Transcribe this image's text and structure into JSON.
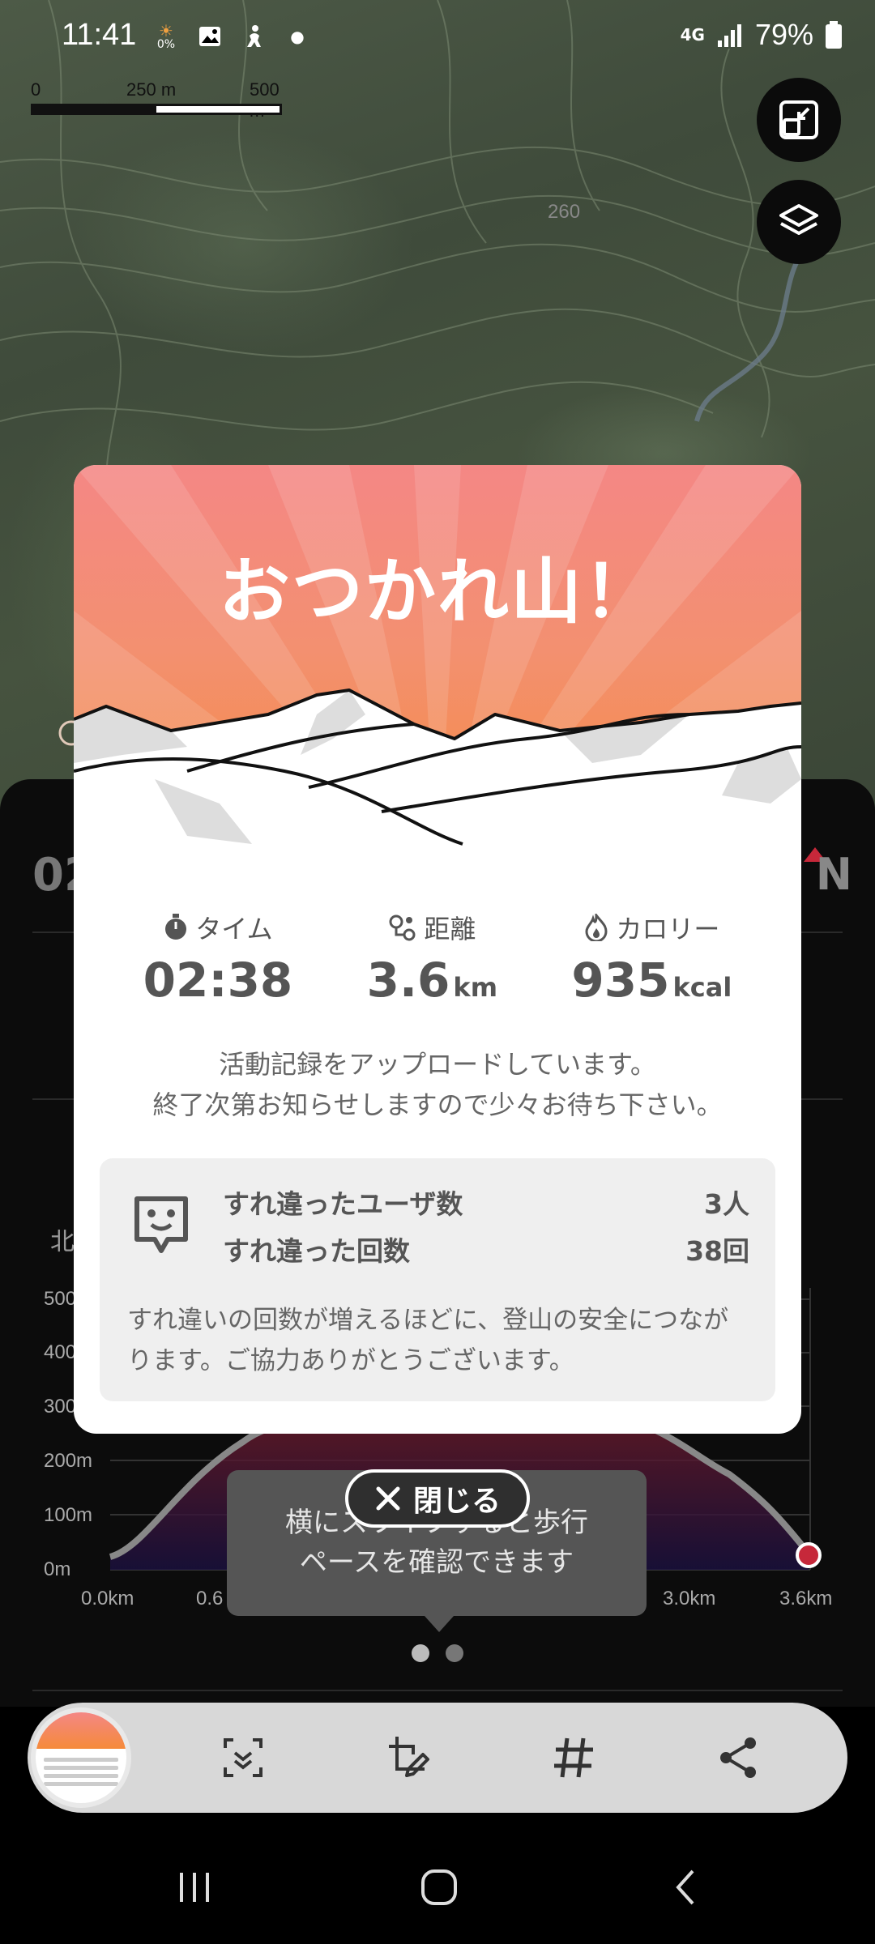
{
  "status_bar": {
    "time": "11:41",
    "small_percent": "0%",
    "network": "4G",
    "battery": "79%"
  },
  "map": {
    "scale_labels": [
      "0",
      "250 m",
      "500 m"
    ],
    "contour_label": "260"
  },
  "background_panel": {
    "left_partial_value": "02",
    "compass_letter": "N",
    "chart_label_partial": "北",
    "y_ticks": [
      "500",
      "400",
      "300",
      "200m",
      "100m",
      "0m"
    ],
    "x_ticks": [
      "0.0km",
      "0.6",
      "3.0km",
      "3.6km"
    ],
    "tooltip_lines": [
      "横にスワイプすると歩行",
      "ペースを確認できます"
    ]
  },
  "dialog": {
    "title": "おつかれ山！",
    "stats": [
      {
        "label": "タイム",
        "icon": "stopwatch-icon",
        "value": "02:38",
        "unit": ""
      },
      {
        "label": "距離",
        "icon": "route-pin-icon",
        "value": "3.6",
        "unit": "km"
      },
      {
        "label": "カロリー",
        "icon": "flame-icon",
        "value": "935",
        "unit": "kcal"
      }
    ],
    "upload_message": [
      "活動記録をアップロードしています。",
      "終了次第お知らせしますので少々お待ち下さい。"
    ],
    "encounter": {
      "users_label": "すれ違ったユーザ数",
      "users_value": "3人",
      "count_label": "すれ違った回数",
      "count_value": "38回",
      "note": "すれ違いの回数が増えるほどに、登山の安全につながります。ご協力ありがとうございます。"
    },
    "close_label": "閉じる"
  },
  "colors": {
    "hero_top": "#f48785",
    "hero_bottom": "#f58a3a",
    "accent_red": "#c6283a"
  }
}
